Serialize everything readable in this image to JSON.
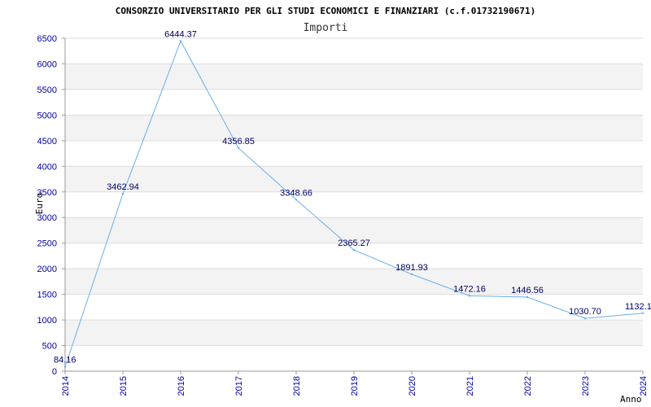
{
  "chart_data": {
    "type": "line",
    "title": "CONSORZIO UNIVERSITARIO PER GLI STUDI ECONOMICI E FINANZIARI (c.f.01732190671)",
    "subtitle": "Importi",
    "xlabel": "Anno",
    "ylabel": "Euro",
    "x": [
      "2014",
      "2015",
      "2016",
      "2017",
      "2018",
      "2019",
      "2020",
      "2021",
      "2022",
      "2023",
      "2024"
    ],
    "series": [
      {
        "values": [
          84.16,
          3462.94,
          6444.37,
          4356.85,
          3348.66,
          2365.27,
          1891.93,
          1472.16,
          1446.56,
          1030.7,
          1132.1
        ],
        "labels": [
          "84.16",
          "3462.94",
          "6444.37",
          "4356.85",
          "3348.66",
          "2365.27",
          "1891.93",
          "1472.16",
          "1446.56",
          "1030.70",
          "1132.1"
        ]
      }
    ],
    "yticks": [
      0,
      500,
      1000,
      1500,
      2000,
      2500,
      3000,
      3500,
      4000,
      4500,
      5000,
      5500,
      6000,
      6500
    ],
    "ylim": [
      0,
      6500
    ],
    "grid": true,
    "colors": {
      "line": "#6aaee8",
      "band": "#f3f3f3",
      "gridline": "#dddddd",
      "tick_label": "#0000aa",
      "data_label": "#000066"
    }
  }
}
